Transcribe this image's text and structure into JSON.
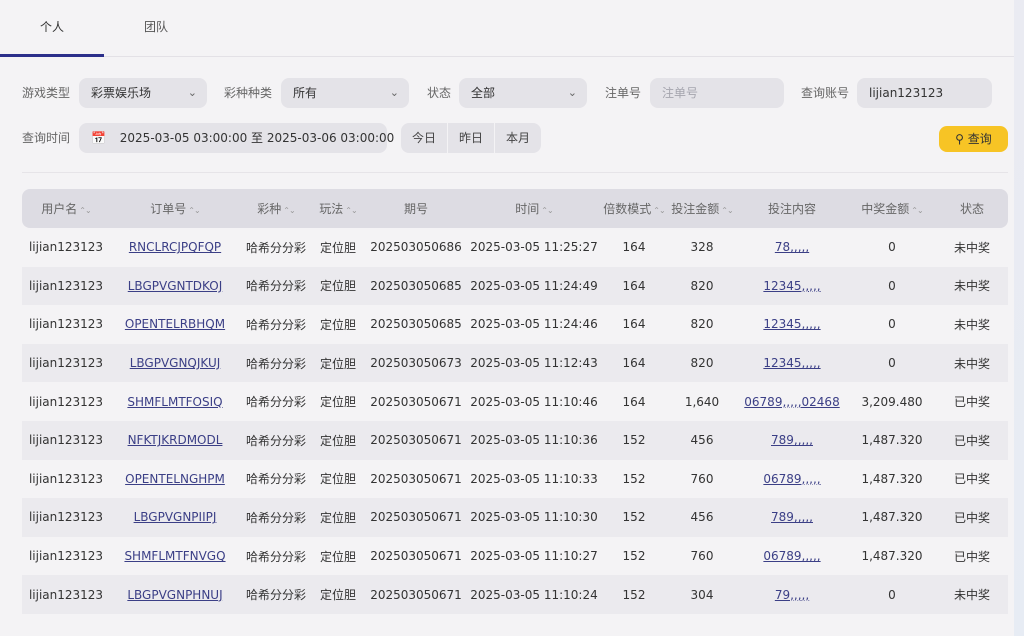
{
  "tabs": [
    "个人",
    "团队"
  ],
  "filters": {
    "game_type_label": "游戏类型",
    "game_type_value": "彩票娱乐场",
    "lottery_label": "彩种种类",
    "lottery_value": "所有",
    "status_label": "状态",
    "status_value": "全部",
    "order_label": "注单号",
    "order_placeholder": "注单号",
    "account_label": "查询账号",
    "account_value": "lijian123123",
    "time_label": "查询时间",
    "time_value": "2025-03-05 03:00:00 至 2025-03-06 03:00:00",
    "quick": [
      "今日",
      "昨日",
      "本月"
    ],
    "search_label": "查询"
  },
  "columns": [
    "用户名",
    "订单号",
    "彩种",
    "玩法",
    "期号",
    "时间",
    "倍数模式",
    "投注金额",
    "投注内容",
    "中奖金额",
    "状态"
  ],
  "rows": [
    [
      "lijian123123",
      "RNCLRCJPQFQP",
      "哈希分分彩",
      "定位胆",
      "202503050686",
      "2025-03-05 11:25:27",
      "164",
      "328",
      "78,,,,,",
      "0",
      "未中奖"
    ],
    [
      "lijian123123",
      "LBGPVGNTDKOJ",
      "哈希分分彩",
      "定位胆",
      "202503050685",
      "2025-03-05 11:24:49",
      "164",
      "820",
      "12345,,,,,",
      "0",
      "未中奖"
    ],
    [
      "lijian123123",
      "OPENTELRBHQM",
      "哈希分分彩",
      "定位胆",
      "202503050685",
      "2025-03-05 11:24:46",
      "164",
      "820",
      "12345,,,,,",
      "0",
      "未中奖"
    ],
    [
      "lijian123123",
      "LBGPVGNQJKUJ",
      "哈希分分彩",
      "定位胆",
      "202503050673",
      "2025-03-05 11:12:43",
      "164",
      "820",
      "12345,,,,,",
      "0",
      "未中奖"
    ],
    [
      "lijian123123",
      "SHMFLMTFOSIQ",
      "哈希分分彩",
      "定位胆",
      "202503050671",
      "2025-03-05 11:10:46",
      "164",
      "1,640",
      "06789,,,,,02468",
      "3,209.480",
      "已中奖"
    ],
    [
      "lijian123123",
      "NFKTJKRDMODL",
      "哈希分分彩",
      "定位胆",
      "202503050671",
      "2025-03-05 11:10:36",
      "152",
      "456",
      "789,,,,,",
      "1,487.320",
      "已中奖"
    ],
    [
      "lijian123123",
      "OPENTELNGHPM",
      "哈希分分彩",
      "定位胆",
      "202503050671",
      "2025-03-05 11:10:33",
      "152",
      "760",
      "06789,,,,,",
      "1,487.320",
      "已中奖"
    ],
    [
      "lijian123123",
      "LBGPVGNPIIPJ",
      "哈希分分彩",
      "定位胆",
      "202503050671",
      "2025-03-05 11:10:30",
      "152",
      "456",
      "789,,,,,",
      "1,487.320",
      "已中奖"
    ],
    [
      "lijian123123",
      "SHMFLMTFNVGQ",
      "哈希分分彩",
      "定位胆",
      "202503050671",
      "2025-03-05 11:10:27",
      "152",
      "760",
      "06789,,,,,",
      "1,487.320",
      "已中奖"
    ],
    [
      "lijian123123",
      "LBGPVGNPHNUJ",
      "哈希分分彩",
      "定位胆",
      "202503050671",
      "2025-03-05 11:10:24",
      "152",
      "304",
      "79,,,,,",
      "0",
      "未中奖"
    ]
  ],
  "sortable_columns": [
    0,
    1,
    2,
    3,
    5,
    6,
    7,
    9
  ],
  "colors": {
    "accent": "#2b2f8a",
    "search_button": "#f7c425",
    "link": "#3b3f86"
  }
}
